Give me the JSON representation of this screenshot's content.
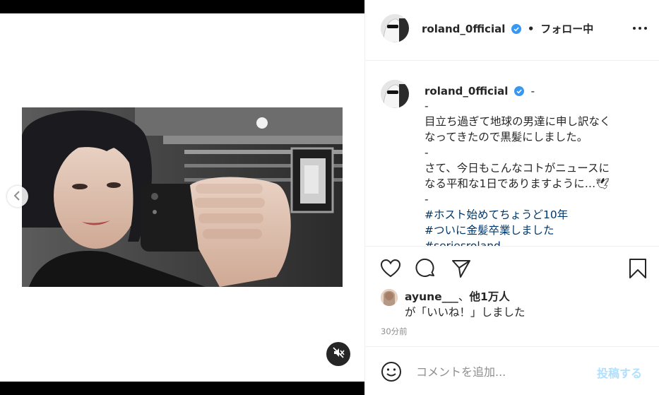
{
  "colors": {
    "text": "#262626",
    "secondary": "#8e8e8e",
    "hashtag": "#00376b",
    "verified": "#3897f0",
    "post_button_disabled": "#b2dffc",
    "divider": "#efefef"
  },
  "media": {
    "mute_icon": "speaker-muted-icon",
    "prev_icon": "chevron-left-icon"
  },
  "header": {
    "username": "roland_0fficial",
    "separator": "•",
    "follow_state": "フォロー中",
    "more_icon": "more-options-icon"
  },
  "caption": {
    "username": "roland_0fficial",
    "first_line": "-",
    "lines": [
      {
        "text": "-",
        "tag": false
      },
      {
        "text": "目立ち過ぎて地球の男達に申し訳なく",
        "tag": false
      },
      {
        "text": "なってきたので黒髪にしました。",
        "tag": false
      },
      {
        "text": "-",
        "tag": false
      },
      {
        "text": "さて、今日もこんなコトがニュースに",
        "tag": false
      },
      {
        "text": "なる平和な1日でありますように…🕊",
        "tag": false
      },
      {
        "text": "-",
        "tag": false
      },
      {
        "text": "#ホスト始めてちょうど10年",
        "tag": true
      },
      {
        "text": "#ついに金髪卒業しました",
        "tag": true
      },
      {
        "text": "#seriesroland",
        "tag": true
      }
    ]
  },
  "actions": {
    "like_icon": "heart-icon",
    "comment_icon": "comment-icon",
    "share_icon": "send-icon",
    "save_icon": "bookmark-icon"
  },
  "likes": {
    "user": "ayune___",
    "sep": "、",
    "others": "他1万人",
    "suffix": "が「いいね！」しました"
  },
  "timestamp": "30分前",
  "comment": {
    "placeholder": "コメントを追加...",
    "post_label": "投稿する",
    "emoji_icon": "emoji-icon"
  }
}
